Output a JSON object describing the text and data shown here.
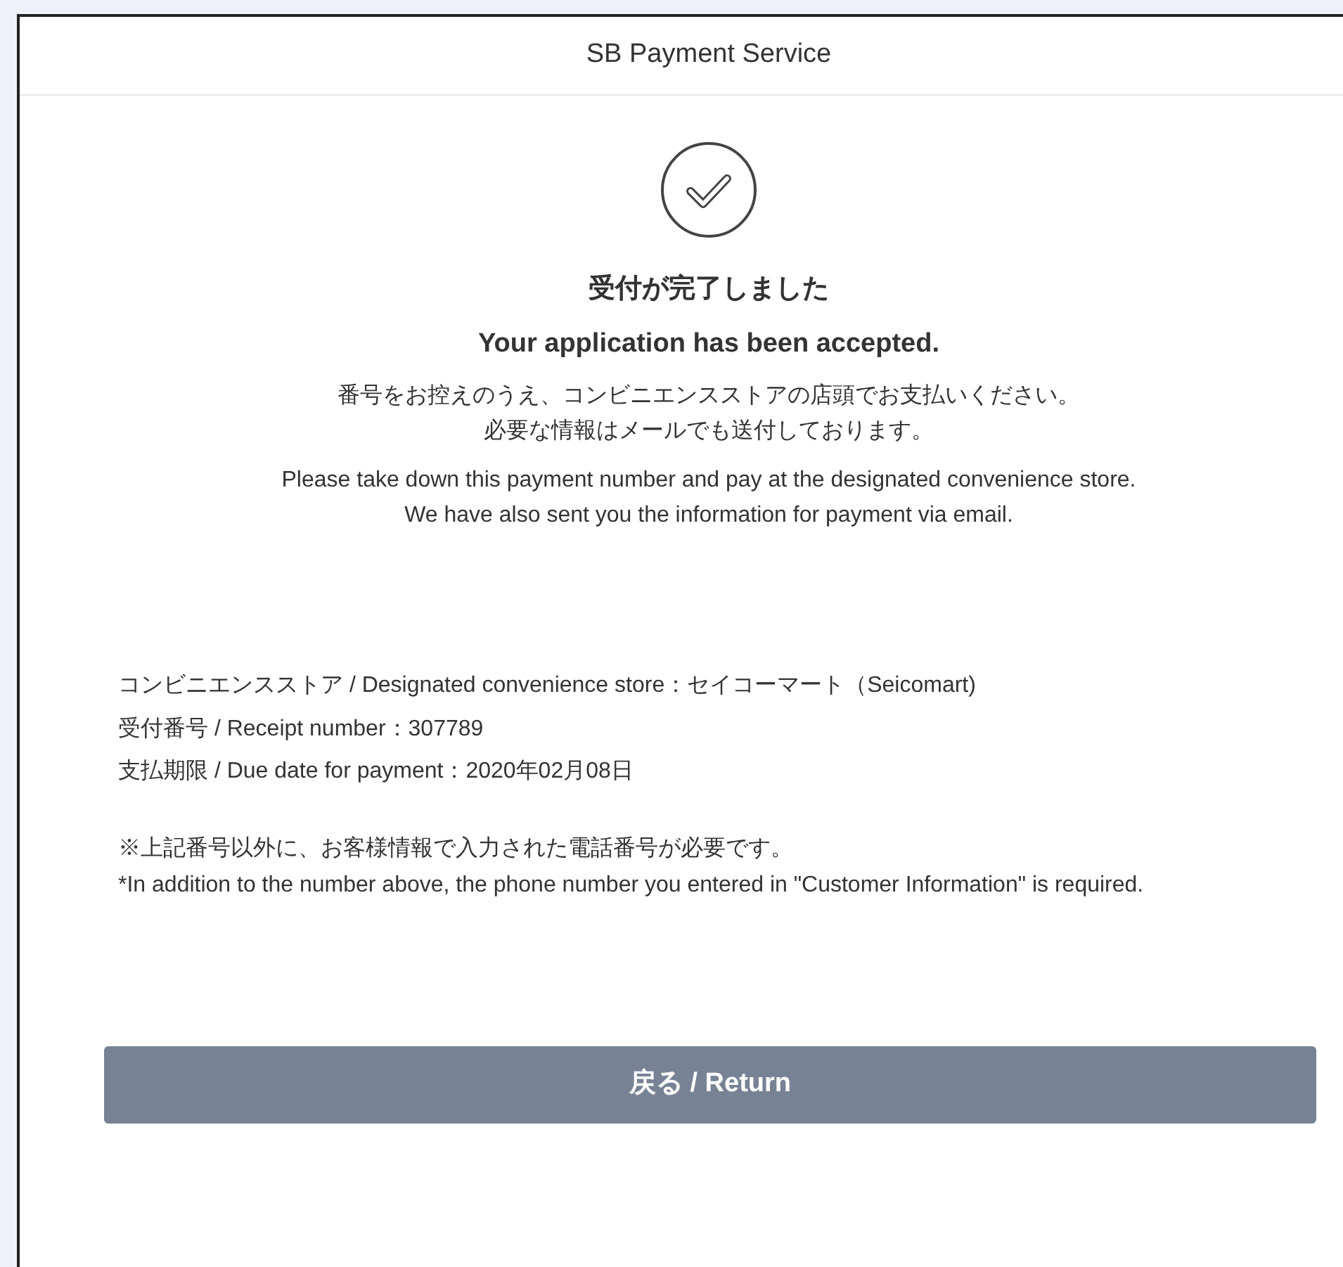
{
  "header": {
    "title": "SB Payment Service"
  },
  "result": {
    "title_ja": "受付が完了しました",
    "title_en": "Your application has been accepted.",
    "message": [
      "番号をお控えのうえ、コンビニエンスストアの店頭でお支払いください。",
      "必要な情報はメールでも送付しております。",
      "Please take down this payment number and pay at the designated convenience store.",
      "We have also sent you the information for payment via email."
    ]
  },
  "details": [
    {
      "label": "コンビニエンスストア / Designated convenience store：",
      "value": "セイコーマート（Seicomart)"
    },
    {
      "label": "受付番号 / Receipt number：",
      "value": "307789"
    },
    {
      "label": "支払期限 / Due date for payment：",
      "value": "2020年02月08日"
    }
  ],
  "notes": [
    "※上記番号以外に、お客様情報で入力された電話番号が必要です。",
    "*In addition to the number above, the phone number you entered in \"Customer Information\" is required."
  ],
  "return_button": "戻る / Return"
}
